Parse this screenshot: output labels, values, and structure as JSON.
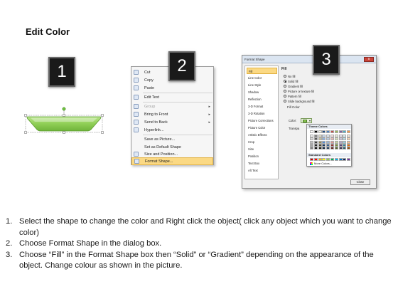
{
  "title": "Edit Color",
  "steps": [
    "1",
    "2",
    "3"
  ],
  "context_menu": {
    "items": [
      {
        "label": "Cut",
        "disabled": false,
        "submenu": false,
        "highlight": false
      },
      {
        "label": "Copy",
        "disabled": false,
        "submenu": false,
        "highlight": false
      },
      {
        "label": "Paste",
        "disabled": false,
        "submenu": false,
        "highlight": false
      },
      {
        "label": "Edit Text",
        "disabled": false,
        "submenu": false,
        "highlight": false
      },
      {
        "label": "Group",
        "disabled": true,
        "submenu": true,
        "highlight": false
      },
      {
        "label": "Bring to Front",
        "disabled": false,
        "submenu": true,
        "highlight": false
      },
      {
        "label": "Send to Back",
        "disabled": false,
        "submenu": true,
        "highlight": false
      },
      {
        "label": "Hyperlink...",
        "disabled": false,
        "submenu": false,
        "highlight": false
      },
      {
        "label": "Save as Picture...",
        "disabled": false,
        "submenu": false,
        "highlight": false
      },
      {
        "label": "Set as Default Shape",
        "disabled": false,
        "submenu": false,
        "highlight": false
      },
      {
        "label": "Size and Position...",
        "disabled": false,
        "submenu": false,
        "highlight": false
      },
      {
        "label": "Format Shape...",
        "disabled": false,
        "submenu": false,
        "highlight": true
      }
    ]
  },
  "format_dialog": {
    "title": "Format Shape",
    "close_label": "x",
    "nav": [
      "Fill",
      "Line Color",
      "Line Style",
      "Shadow",
      "Reflection",
      "3-D Format",
      "3-D Rotation",
      "Picture Corrections",
      "Picture Color",
      "Artistic Effects",
      "Crop",
      "Size",
      "Position",
      "Text Box",
      "Alt Text"
    ],
    "selected_nav": "Fill",
    "fill_heading": "Fill",
    "fill_options": [
      "No fill",
      "Solid fill",
      "Gradient fill",
      "Picture or texture fill",
      "Pattern fill",
      "Slide background fill"
    ],
    "selected_fill": "Solid fill",
    "fill_color_heading": "Fill Color",
    "color_label": "Color:",
    "transparency_label": "Transpa",
    "picker": {
      "theme_heading": "Theme Colors",
      "standard_heading": "Standard Colors",
      "more_label": "More Colors...",
      "theme_top": [
        "#ffffff",
        "#000000",
        "#eeece1",
        "#1f497d",
        "#4f81bd",
        "#c0504d",
        "#9bbb59",
        "#8064a2",
        "#4bacc6",
        "#f79646"
      ],
      "theme_shades": [
        [
          "#f2f2f2",
          "#7f7f7f",
          "#ddd9c3",
          "#c6d9f0",
          "#dbe5f1",
          "#f2dcdb",
          "#ebf1dd",
          "#e5e0ec",
          "#dbeef3",
          "#fdeada"
        ],
        [
          "#d8d8d8",
          "#595959",
          "#c4bd97",
          "#8db3e2",
          "#b8cce4",
          "#e5b9b7",
          "#d7e3bc",
          "#ccc1d9",
          "#b7dde8",
          "#fbd5b5"
        ],
        [
          "#bfbfbf",
          "#3f3f3f",
          "#938953",
          "#548dd4",
          "#95b3d7",
          "#d99694",
          "#c3d69b",
          "#b2a2c7",
          "#92cddc",
          "#fac08f"
        ],
        [
          "#a5a5a5",
          "#262626",
          "#494429",
          "#17365d",
          "#366092",
          "#953734",
          "#76923c",
          "#5f497a",
          "#31859b",
          "#e36c09"
        ],
        [
          "#7f7f7f",
          "#0c0c0c",
          "#1d1b10",
          "#0f243e",
          "#244061",
          "#632423",
          "#4f6128",
          "#3f3151",
          "#205867",
          "#974806"
        ]
      ],
      "standard": [
        "#c00000",
        "#ff0000",
        "#ffc000",
        "#ffff00",
        "#92d050",
        "#00b050",
        "#00b0f0",
        "#0070c0",
        "#002060",
        "#7030a0"
      ]
    },
    "close_button": "Close"
  },
  "instructions": [
    {
      "num": "1.",
      "text": "Select the shape to change the color and Right click the object( click any object which you want to change color)"
    },
    {
      "num": "2.",
      "text": "Choose Format Shape in the dialog box."
    },
    {
      "num": "3.",
      "text": "Choose “Fill” in the Format Shape box then “Solid” or “Gradient” depending on the appearance of the object. Change colour as shown in the picture."
    }
  ],
  "colors": {
    "shape_fill": "#8fce55",
    "shape_stroke": "#5a9a2e",
    "highlight": "#fbd984"
  }
}
